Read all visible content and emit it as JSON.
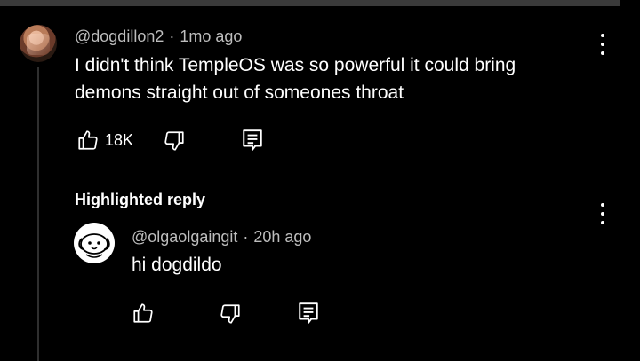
{
  "comment": {
    "handle": "@dogdillon2",
    "separator": "·",
    "time": "1mo ago",
    "text_line1": "I didn't think TempleOS was so powerful it could bring",
    "text_line2": "demons straight out of someones throat",
    "likes": "18K",
    "icons": [
      "like-icon",
      "dislike-icon",
      "reply-icon",
      "more-options-icon"
    ]
  },
  "reply_section": {
    "label": "Highlighted reply"
  },
  "reply": {
    "handle": "@olgaolgaingit",
    "separator": "·",
    "time": "20h ago",
    "text": "hi dogdildo",
    "icons": [
      "like-icon",
      "dislike-icon",
      "reply-icon",
      "more-options-icon"
    ]
  },
  "colors": {
    "background": "#000000",
    "text": "#ffffff",
    "meta_text": "#bdbdbd",
    "top_bar": "#3a3a3a",
    "thread_line": "#2f2f2f"
  }
}
